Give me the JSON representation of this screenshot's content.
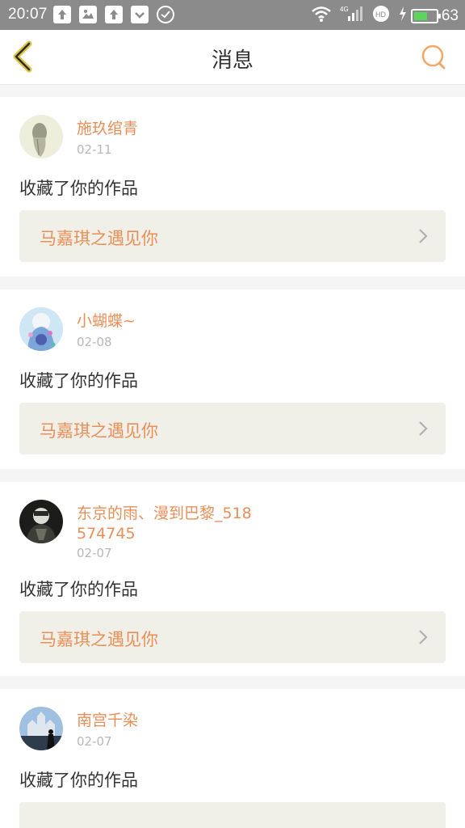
{
  "status_bar": {
    "time": "20:07",
    "network_label": "4G",
    "battery_level": "63"
  },
  "header": {
    "title": "消息",
    "accent_color": "#e88f58"
  },
  "messages": [
    {
      "user_name": "施玖绾青",
      "date": "02-11",
      "action": "收藏了你的作品",
      "work_title": "马嘉琪之遇见你"
    },
    {
      "user_name": "小蝴蝶~",
      "date": "02-08",
      "action": "收藏了你的作品",
      "work_title": "马嘉琪之遇见你"
    },
    {
      "user_name": "东京的雨、漫到巴黎_518574745",
      "date": "02-07",
      "action": "收藏了你的作品",
      "work_title": "马嘉琪之遇见你"
    },
    {
      "user_name": "南宫千染",
      "date": "02-07",
      "action": "收藏了你的作品",
      "work_title": ""
    }
  ]
}
